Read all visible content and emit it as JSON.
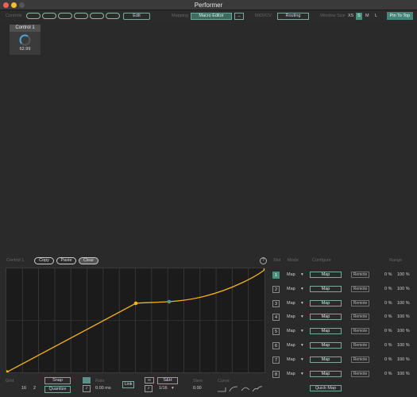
{
  "window": {
    "title": "Performer"
  },
  "toolbar": {
    "controls_label": "Controls",
    "edit_label": "Edit",
    "mapping_label": "Mapping",
    "macro_editor_label": "Macro Editor",
    "arrow_label": "→",
    "midi_cv_label": "MIDI/CV",
    "routing_label": "Routing",
    "window_size_label": "Window Size",
    "sizes": [
      "XS",
      "S",
      "M",
      "L"
    ],
    "selected_size": "S",
    "pin_label": "Pin To Top"
  },
  "control": {
    "name": "Control 1",
    "value": "62.99",
    "fraction": 0.63
  },
  "macro": {
    "title": "Control 1",
    "copy_label": "Copy",
    "paste_label": "Paste",
    "clear_label": "Clear",
    "help_label": "?",
    "colors": {
      "curve": "#f5b21a",
      "mid_point": "#5a9a85"
    }
  },
  "mapping_table": {
    "headers": {
      "slot": "Slot",
      "mode": "Mode",
      "configure": "Configure",
      "range": "Range"
    },
    "rows": [
      {
        "index": "1",
        "mode": "Map",
        "map_label": "Map",
        "remote_label": "Remote",
        "min": "0 %",
        "max": "100 %"
      },
      {
        "index": "2",
        "mode": "Map",
        "map_label": "Map",
        "remote_label": "Remote",
        "min": "0 %",
        "max": "100 %"
      },
      {
        "index": "3",
        "mode": "Map",
        "map_label": "Map",
        "remote_label": "Remote",
        "min": "0 %",
        "max": "100 %"
      },
      {
        "index": "4",
        "mode": "Map",
        "map_label": "Map",
        "remote_label": "Remote",
        "min": "0 %",
        "max": "100 %"
      },
      {
        "index": "5",
        "mode": "Map",
        "map_label": "Map",
        "remote_label": "Remote",
        "min": "0 %",
        "max": "100 %"
      },
      {
        "index": "6",
        "mode": "Map",
        "map_label": "Map",
        "remote_label": "Remote",
        "min": "0 %",
        "max": "100 %"
      },
      {
        "index": "7",
        "mode": "Map",
        "map_label": "Map",
        "remote_label": "Remote",
        "min": "0 %",
        "max": "100 %"
      },
      {
        "index": "8",
        "mode": "Map",
        "map_label": "Map",
        "remote_label": "Remote",
        "min": "0 %",
        "max": "100 %"
      }
    ],
    "quick_map_label": "Quick Map"
  },
  "bottom": {
    "grid_label": "Grid",
    "grid_x": "16",
    "grid_y": "2",
    "snap_label": "Snap",
    "quantize_label": "Quantize",
    "rate_label": "Rate",
    "rate_value": "0.00 ms",
    "sh_label": "S&H",
    "sh_value": "1/16",
    "link_label": "Link",
    "slew_label": "Slew",
    "slew_value": "0.00",
    "curve_label": "Curve"
  }
}
